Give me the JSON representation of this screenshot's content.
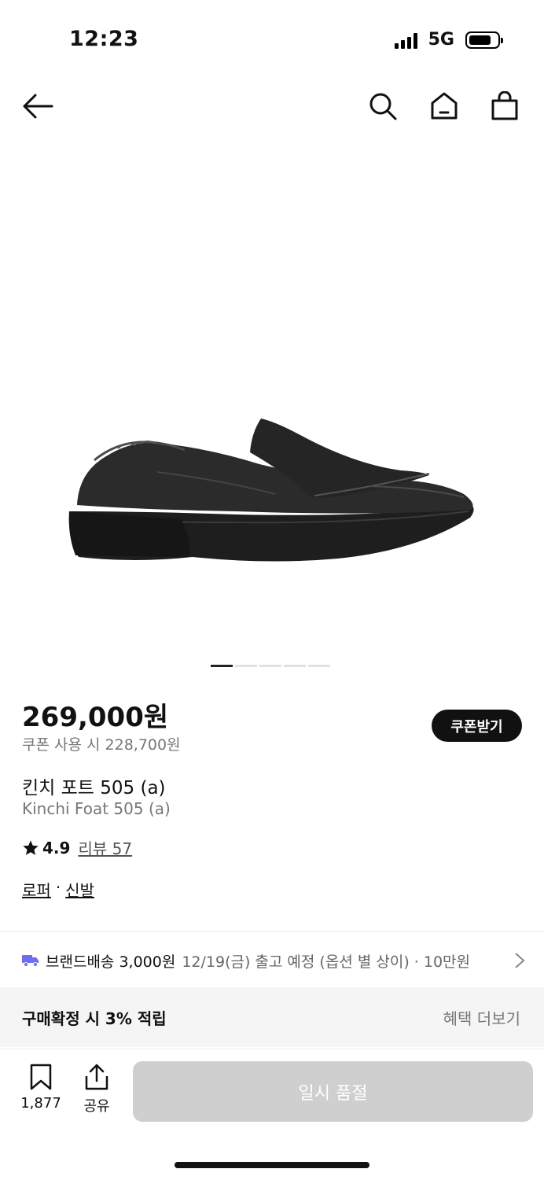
{
  "status_bar": {
    "time": "12:23",
    "network": "5G"
  },
  "product": {
    "price": "269,000원",
    "coupon_price": "쿠폰 사용 시 228,700원",
    "coupon_button": "쿠폰받기",
    "title_ko": "킨치 포트 505 (a)",
    "title_en": "Kinchi Foat 505 (a)",
    "rating": "4.9",
    "review_link": "리뷰 57",
    "categories": [
      "로퍼",
      "신발"
    ],
    "category_sep": "·",
    "image_pages": 5,
    "active_image": 1
  },
  "shipping": {
    "brand_text": "브랜드배송 3,000원",
    "eta_text": "12/19(금) 출고 예정 (옵션 별 상이) · 10만원"
  },
  "benefit": {
    "text": "구매확정 시 3% 적립",
    "more": "혜택 더보기"
  },
  "bottom": {
    "bookmark_count": "1,877",
    "share_label": "공유",
    "buy_button": "일시 품절"
  },
  "icons": {
    "back": "arrow-left-icon",
    "search": "search-icon",
    "home": "home-icon",
    "cart": "shopping-bag-icon",
    "truck": "truck-icon",
    "chevron": "chevron-right-icon",
    "bookmark": "bookmark-icon",
    "share": "share-icon",
    "star": "star-icon"
  },
  "colors": {
    "truck": "#6b6ef0",
    "soldout_button": "#cfcfcf",
    "coupon_button": "#111111"
  }
}
